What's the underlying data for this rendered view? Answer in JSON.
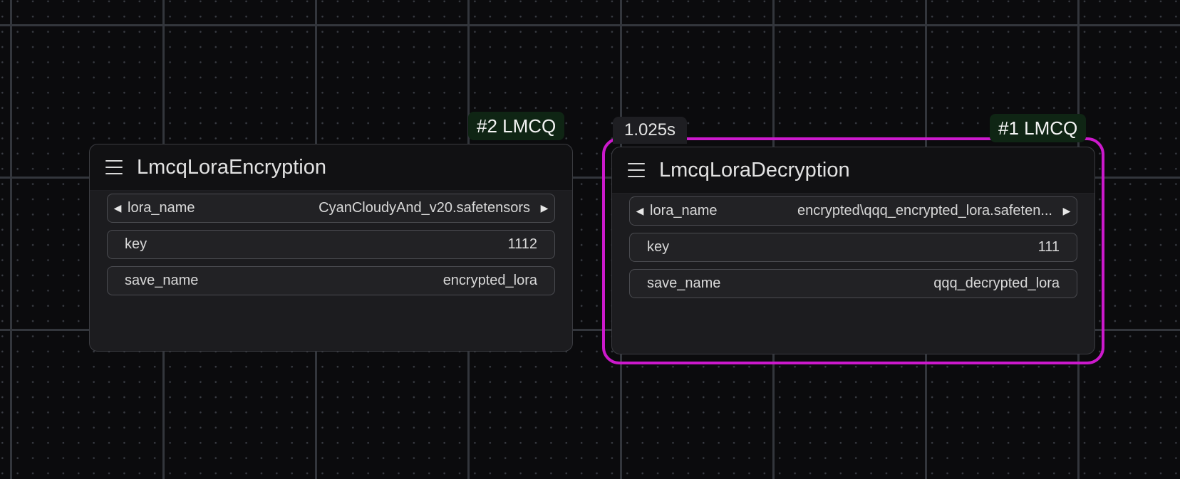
{
  "nodes": {
    "encryption": {
      "badge": "#2 LMCQ",
      "title": "LmcqLoraEncryption",
      "lora_name": {
        "label": "lora_name",
        "value": "CyanCloudyAnd_v20.safetensors"
      },
      "key": {
        "label": "key",
        "value": "1112"
      },
      "save_name": {
        "label": "save_name",
        "value": "encrypted_lora"
      }
    },
    "decryption": {
      "badge": "#1 LMCQ",
      "timer": "1.025s",
      "title": "LmcqLoraDecryption",
      "lora_name": {
        "label": "lora_name",
        "value": "encrypted\\qqq_encrypted_lora.safeten..."
      },
      "key": {
        "label": "key",
        "value": "111"
      },
      "save_name": {
        "label": "save_name",
        "value": "qqq_decrypted_lora"
      }
    }
  },
  "icons": {
    "menu": "hamburger-menu-icon",
    "left_arrow": "◀",
    "right_arrow": "▶"
  },
  "colors": {
    "selection": "#cc19cc",
    "badge_bg": "#0f2514",
    "node_bg": "#1c1c1f"
  }
}
